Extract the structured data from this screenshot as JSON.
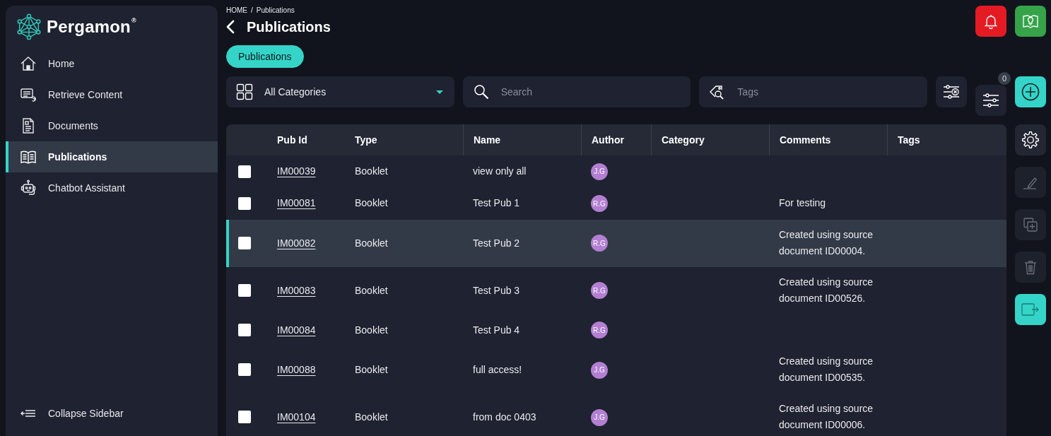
{
  "brand": {
    "name": "Pergamon$^{®}$"
  },
  "sidebar": {
    "items": [
      {
        "label": "Home",
        "selected": false
      },
      {
        "label": "Retrieve Content",
        "selected": false
      },
      {
        "label": "Documents",
        "selected": false
      },
      {
        "label": "Publications",
        "selected": true
      },
      {
        "label": "Chatbot Assistant",
        "selected": false
      }
    ],
    "collapse_label": "Collapse Sidebar"
  },
  "breadcrumb": {
    "items": [
      "HOME",
      "Publications"
    ],
    "separator": "/"
  },
  "page_title": "Publications",
  "header_actions": [
    {
      "kind": "notifications"
    },
    {
      "kind": "guide"
    }
  ],
  "tabs": [
    {
      "label": "Publications",
      "selected": true
    }
  ],
  "filters": {
    "category": {
      "value": "All Categories"
    },
    "search": {
      "placeholder": "Search"
    },
    "tags": {
      "placeholder": "Tags"
    }
  },
  "toolbar_actions": [
    {
      "kind": "clear_filters"
    },
    {
      "kind": "filters",
      "badge": "0"
    },
    {
      "kind": "add"
    }
  ],
  "table": {
    "columns": [
      {
        "label": "Pub Id"
      },
      {
        "label": "Type"
      },
      {
        "label": "Name"
      },
      {
        "label": "Author"
      },
      {
        "label": "Category"
      },
      {
        "label": "Comments"
      },
      {
        "label": "Tags"
      }
    ],
    "rows": [
      {
        "pub_id": "IM00039",
        "type": "Booklet",
        "name": "view only all",
        "author": "J.G",
        "checked": false,
        "selected": false
      },
      {
        "pub_id": "IM00081",
        "type": "Booklet",
        "name": "Test Pub 1",
        "author": "R.G",
        "comments": "For testing",
        "checked": false,
        "selected": false
      },
      {
        "pub_id": "IM00082",
        "type": "Booklet",
        "name": "Test Pub 2",
        "author": "R.G",
        "comments": "Created using source document ID00004.",
        "checked": false,
        "selected": true
      },
      {
        "pub_id": "IM00083",
        "type": "Booklet",
        "name": "Test Pub 3",
        "author": "R.G",
        "comments": "Created using source document ID00526.",
        "checked": false,
        "selected": false
      },
      {
        "pub_id": "IM00084",
        "type": "Booklet",
        "name": "Test Pub 4",
        "author": "R.G",
        "checked": false,
        "selected": false
      },
      {
        "pub_id": "IM00088",
        "type": "Booklet",
        "name": "full access!",
        "author": "J.G",
        "comments": "Created using source document ID00535.",
        "checked": false,
        "selected": false
      },
      {
        "pub_id": "IM00104",
        "type": "Booklet",
        "name": "from doc 0403",
        "author": "J.G",
        "comments": "Created using source document ID00006.",
        "checked": false,
        "selected": false
      }
    ]
  },
  "side_actions": [
    {
      "kind": "settings",
      "disabled": false
    },
    {
      "kind": "edit",
      "disabled": true
    },
    {
      "kind": "duplicate",
      "disabled": true
    },
    {
      "kind": "delete",
      "disabled": true
    },
    {
      "kind": "export",
      "disabled": false
    }
  ]
}
